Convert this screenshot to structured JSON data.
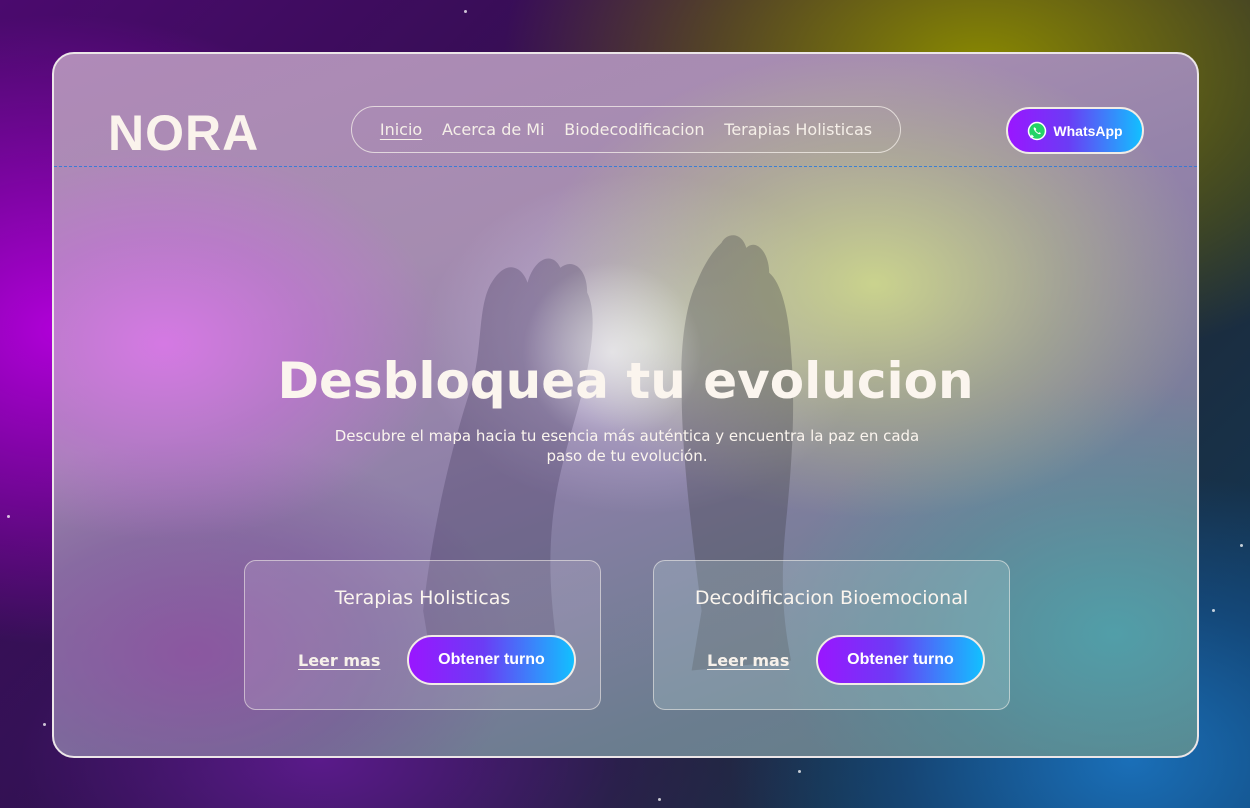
{
  "brand": {
    "logo": "NORA"
  },
  "nav": {
    "items": [
      {
        "label": "Inicio",
        "active": true
      },
      {
        "label": "Acerca de Mi",
        "active": false
      },
      {
        "label": "Biodecodificacion",
        "active": false
      },
      {
        "label": "Terapias Holisticas",
        "active": false
      }
    ]
  },
  "header": {
    "whatsapp_label": "WhatsApp",
    "whatsapp_icon": "whatsapp-icon"
  },
  "hero": {
    "title": "Desbloquea tu evolucion",
    "subtitle": "Descubre el mapa hacia tu esencia más auténtica y encuentra la paz en cada paso de tu evolución."
  },
  "cards": [
    {
      "title": "Terapias Holisticas",
      "read_more": "Leer mas",
      "cta": "Obtener turno"
    },
    {
      "title": "Decodificacion Bioemocional",
      "read_more": "Leer mas",
      "cta": "Obtener turno"
    }
  ],
  "colors": {
    "button_gradient_start": "#9a16ff",
    "button_gradient_end": "#12c0ff",
    "text_light": "#fbf5ee",
    "frame_border": "#ece6e8"
  }
}
